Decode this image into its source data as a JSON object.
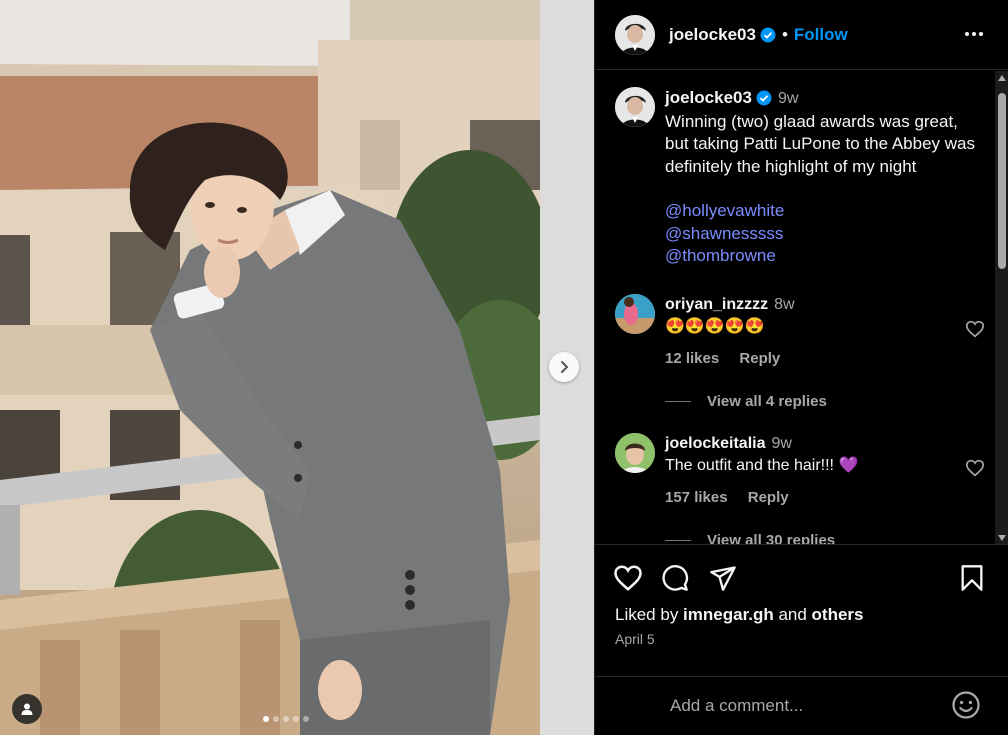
{
  "post": {
    "username": "joelocke03",
    "follow_label": "Follow",
    "separator": "•"
  },
  "caption": {
    "username": "joelocke03",
    "time": "9w",
    "text": "Winning (two) glaad awards was great, but taking Patti LuPone to the Abbey was definitely the highlight of my night",
    "mentions": [
      "@hollyevawhite",
      "@shawnesssss",
      "@thombrowne"
    ]
  },
  "comments": [
    {
      "username": "oriyan_inzzzz",
      "time": "8w",
      "text": "😍😍😍😍😍",
      "likes": "12 likes",
      "reply_label": "Reply",
      "replies_label": "View all 4 replies"
    },
    {
      "username": "joelockeitalia",
      "time": "9w",
      "text": "The outfit and the hair!!! 💜",
      "likes": "157 likes",
      "reply_label": "Reply",
      "replies_label": "View all 30 replies"
    }
  ],
  "liked_by": {
    "prefix": "Liked by ",
    "user": "imnegar.gh",
    "mid": " and ",
    "others": "others"
  },
  "date": "April 5",
  "add_comment": {
    "placeholder": "Add a comment..."
  },
  "carousel": {
    "slide_count": 5,
    "active_index": 0
  },
  "colors": {
    "accent": "#0095f6",
    "verified": "#0095f6",
    "mention": "#7b8cff",
    "panel_bg": "#000000"
  },
  "icons": [
    "verified-badge-icon",
    "more-options-icon",
    "like-icon",
    "comment-icon",
    "share-icon",
    "save-icon",
    "emoji-icon",
    "next-slide-icon",
    "tag-user-icon"
  ]
}
